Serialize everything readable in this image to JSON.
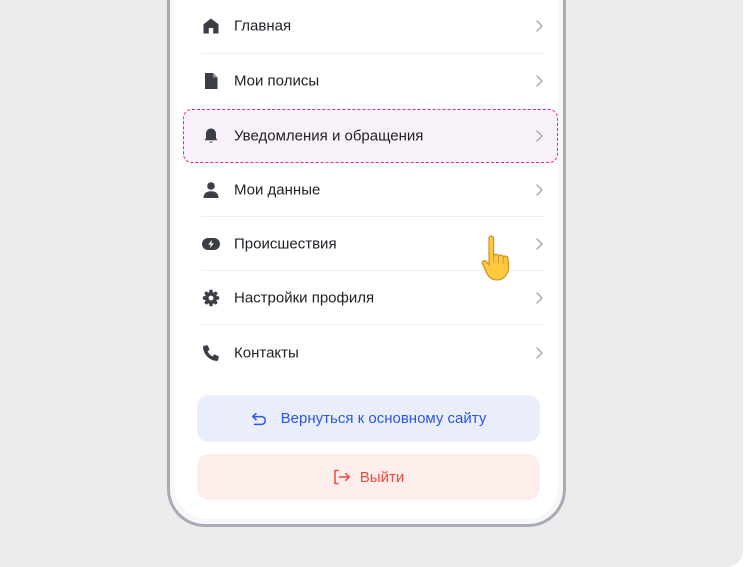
{
  "menu": {
    "items": [
      {
        "label": "Главная",
        "icon": "home-icon"
      },
      {
        "label": "Мои полисы",
        "icon": "document-icon"
      },
      {
        "label": "Уведомления и обращения",
        "icon": "bell-icon",
        "highlighted": true
      },
      {
        "label": "Мои данные",
        "icon": "user-icon"
      },
      {
        "label": "Происшествия",
        "icon": "lightning-icon"
      },
      {
        "label": "Настройки профиля",
        "icon": "gear-icon"
      },
      {
        "label": "Контакты",
        "icon": "phone-icon"
      }
    ]
  },
  "actions": {
    "back_label": "Вернуться к основному сайту",
    "logout_label": "Выйти"
  },
  "colors": {
    "accent_blue": "#2a55e8",
    "danger_red": "#ef4a3c",
    "highlight_border": "#d42f8a",
    "icon_dark": "#3b3d47"
  },
  "cursor": {
    "icon": "pointing-hand-cursor-icon"
  }
}
